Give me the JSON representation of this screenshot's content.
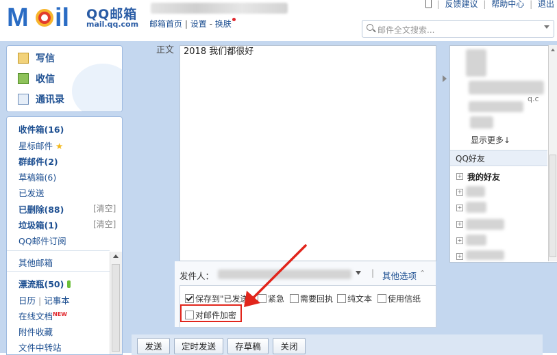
{
  "header": {
    "logo_cn": "QQ邮箱",
    "logo_domain": "mail.qq.com",
    "nav": {
      "home": "邮箱首页",
      "sep": "|",
      "settings": "设置",
      "dash": "-",
      "skin": "换肤"
    },
    "top_links": [
      "反馈建议",
      "帮助中心",
      "退出"
    ],
    "search_placeholder": "邮件全文搜索..."
  },
  "sidebar": {
    "quick": {
      "compose": "写信",
      "inbox": "收信",
      "contacts": "通讯录"
    },
    "folders": {
      "inbox": "收件箱(16)",
      "starred": "星标邮件",
      "group": "群邮件(2)",
      "drafts": "草稿箱(6)",
      "sent": "已发送",
      "deleted": "已删除(88)",
      "deleted_clear": "[清空]",
      "spam": "垃圾箱(1)",
      "spam_clear": "[清空]",
      "subscribe": "QQ邮件订阅",
      "other": "其他邮箱",
      "bottle": "漂流瓶(50)",
      "calendar": "日历",
      "memo": "记事本",
      "docs": "在线文档",
      "docs_badge": "NEW",
      "attachments": "附件收藏",
      "transfer": "文件中转站"
    }
  },
  "compose": {
    "body_label": "正文",
    "body_text": "2018 我们都很好",
    "sender_label": "发件人：",
    "more_options": "其他选项",
    "options": {
      "save_sent": "保存到\"已发送\"",
      "save_sent_checked": true,
      "urgent": "紧急",
      "receipt": "需要回执",
      "plain_text": "纯文本",
      "stationery": "使用信纸",
      "encrypt": "对邮件加密"
    },
    "buttons": [
      "发送",
      "定时发送",
      "存草稿",
      "关闭"
    ]
  },
  "right_panel": {
    "email_fragment": "q.c",
    "show_more": "显示更多↓",
    "qq_friends": "QQ好友",
    "my_friends": "我的好友"
  },
  "colors": {
    "highlight_box": "#e1251b",
    "link": "#1d4f91",
    "frame": "#c4d7ef"
  }
}
